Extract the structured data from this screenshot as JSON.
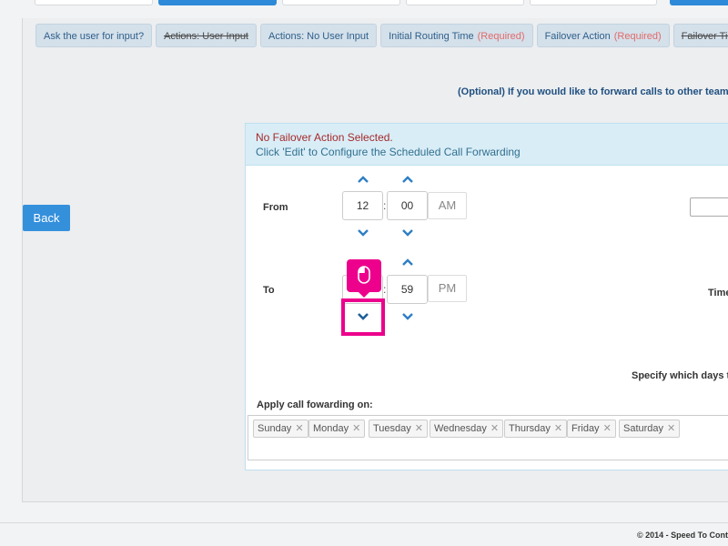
{
  "tabs": [
    {
      "label": "Ask the user for input?",
      "strike": false,
      "required": ""
    },
    {
      "label": "Actions: User Input",
      "strike": true,
      "required": ""
    },
    {
      "label": "Actions: No User Input",
      "strike": false,
      "required": ""
    },
    {
      "label": "Initial Routing Time",
      "strike": false,
      "required": "(Required)"
    },
    {
      "label": "Failover Action",
      "strike": false,
      "required": "(Required)"
    },
    {
      "label": "Failover Timeout",
      "strike": true,
      "required": ""
    }
  ],
  "optional_note": "(Optional) If you would like to forward calls to other team",
  "back_label": "Back",
  "card": {
    "warning": "No Failover Action Selected.",
    "info": "Click 'Edit' to Configure the Scheduled Call Forwarding"
  },
  "from": {
    "label": "From",
    "hour": "12",
    "minute": "00",
    "ampm": "AM"
  },
  "to": {
    "label": "To",
    "hour": "",
    "minute": "59",
    "ampm": "PM"
  },
  "time_label_right": "Time",
  "specify_days": "Specify which days to",
  "apply_label": "Apply call fowarding on:",
  "days": [
    "Sunday",
    "Monday",
    "Tuesday",
    "Wednesday",
    "Thursday",
    "Friday",
    "Saturday"
  ],
  "footer": "© 2014 - Speed To Cont",
  "colors": {
    "accent": "#3590dc",
    "highlight": "#ec008c",
    "warning": "#a52a2a",
    "info": "#31708f"
  },
  "icons": {
    "chevron_up": "chevron-up-icon",
    "chevron_down": "chevron-down-icon",
    "mouse": "mouse-icon"
  }
}
